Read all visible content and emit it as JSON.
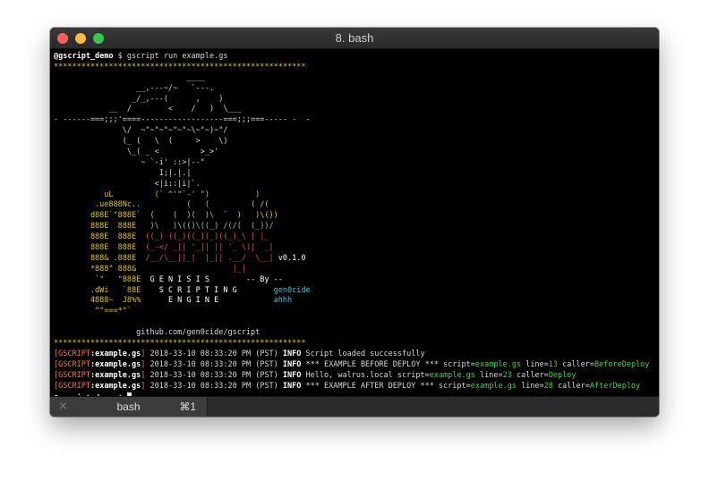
{
  "window": {
    "title": "8. bash"
  },
  "terminal": {
    "prompt_user": "@gscript_demo",
    "prompt_symbol": "$",
    "command": "gscript run example.gs",
    "separator": "*******************************************************",
    "art": [
      {
        "segs": [
          {
            "t": "                             ____",
            "c": ""
          }
        ]
      },
      {
        "segs": [
          {
            "t": "                  __,---~/~   `---.",
            "c": ""
          }
        ]
      },
      {
        "segs": [
          {
            "t": "                 _/_,---(      ,    )",
            "c": ""
          }
        ]
      },
      {
        "segs": [
          {
            "t": "            __  /        <    /   )  \\___",
            "c": ""
          }
        ]
      },
      {
        "segs": [
          {
            "t": "- ------===;;;'====------------------===;;;===----- -  -",
            "c": ""
          }
        ]
      },
      {
        "segs": [
          {
            "t": "               \\/  ~\"~\"~\"~\"~\"~\\~\"~)~\"/",
            "c": ""
          }
        ]
      },
      {
        "segs": [
          {
            "t": "               (_ (   \\  (     >    \\)",
            "c": ""
          }
        ]
      },
      {
        "segs": [
          {
            "t": "                \\_( _ <         >_>'",
            "c": ""
          }
        ]
      },
      {
        "segs": [
          {
            "t": "                   ~ `-i' ::>|--\"",
            "c": ""
          }
        ]
      },
      {
        "segs": [
          {
            "t": "                       I;|.|.|",
            "c": ""
          }
        ]
      },
      {
        "segs": [
          {
            "t": "                      <|i::|i|`.",
            "c": ""
          }
        ]
      },
      {
        "segs": [
          {
            "t": "           uL         (` ^'\"`-' \")          )",
            "c": "y"
          }
        ]
      },
      {
        "segs": [
          {
            "t": "         .ue888Nc..          (   (         ( /(",
            "c": "y"
          }
        ]
      },
      {
        "segs": [
          {
            "t": "        d88E`\"888E`  ",
            "c": "y"
          },
          {
            "t": "(    (  )(  )\\  `  )   )\\())",
            "c": "y"
          }
        ]
      },
      {
        "segs": [
          {
            "t": "        888E  888E   ",
            "c": "y"
          },
          {
            "t": ")\\   )\\(()\\((_) /(/(  (_))/",
            "c": "g"
          }
        ]
      },
      {
        "segs": [
          {
            "t": "        888E  888E  ",
            "c": "y"
          },
          {
            "t": "((_) ((_)((_)(_)((_)_\\ | |_",
            "c": "r"
          }
        ]
      },
      {
        "segs": [
          {
            "t": "        888E  888E  ",
            "c": "y"
          },
          {
            "t": "(_-</ _|| '_|| || '_ \\)|  _|",
            "c": "r"
          }
        ]
      },
      {
        "segs": [
          {
            "t": "        888& .888E  ",
            "c": "y"
          },
          {
            "t": "/__/\\__||_|  |_|| .__/  \\__| ",
            "c": "r"
          },
          {
            "t": "v0.1.0",
            "c": "w"
          }
        ]
      },
      {
        "segs": [
          {
            "t": "        *888\" 888&                     ",
            "c": "y"
          },
          {
            "t": "|_|",
            "c": "r"
          }
        ]
      },
      {
        "segs": [
          {
            "t": "         `\"   \"888E  ",
            "c": "y"
          },
          {
            "t": "G E N I S I S        -- By --",
            "c": "w"
          }
        ]
      },
      {
        "segs": [
          {
            "t": "        .dWi   `88E    ",
            "c": "y"
          },
          {
            "t": "S C R I P T I N G",
            "c": "w"
          },
          {
            "t": "        gen0cide",
            "c": "c"
          }
        ]
      },
      {
        "segs": [
          {
            "t": "        4888~  J8%%      ",
            "c": "y"
          },
          {
            "t": "E N G I N E",
            "c": "w"
          },
          {
            "t": "            ahhh",
            "c": "c"
          }
        ]
      },
      {
        "segs": [
          {
            "t": "         ^\"===*\"`",
            "c": "y"
          }
        ]
      }
    ],
    "url": "github.com/gen0cide/gscript",
    "logs": [
      {
        "tag": "GSCRIPT",
        "file": "example.gs",
        "time": "2018-33-10 08:33:20 PM (PST)",
        "level": "INFO",
        "segs": [
          {
            "t": "Script loaded successfully",
            "c": ""
          }
        ]
      },
      {
        "tag": "GSCRIPT",
        "file": "example.gs",
        "time": "2018-33-10 08:33:20 PM (PST)",
        "level": "INFO",
        "segs": [
          {
            "t": "*** EXAMPLE BEFORE DEPLOY *** script=",
            "c": ""
          },
          {
            "t": "example.gs",
            "c": "gr"
          },
          {
            "t": " line=",
            "c": ""
          },
          {
            "t": "13",
            "c": "gr"
          },
          {
            "t": " caller=",
            "c": ""
          },
          {
            "t": "BeforeDeploy",
            "c": "gr"
          }
        ]
      },
      {
        "tag": "GSCRIPT",
        "file": "example.gs",
        "time": "2018-33-10 08:33:20 PM (PST)",
        "level": "INFO",
        "segs": [
          {
            "t": "Hello, walrus.local script=",
            "c": ""
          },
          {
            "t": "example.gs",
            "c": "gr"
          },
          {
            "t": " line=",
            "c": ""
          },
          {
            "t": "23",
            "c": "gr"
          },
          {
            "t": " caller=",
            "c": ""
          },
          {
            "t": "Deploy",
            "c": "gr"
          }
        ]
      },
      {
        "tag": "GSCRIPT",
        "file": "example.gs",
        "time": "2018-33-10 08:33:20 PM (PST)",
        "level": "INFO",
        "segs": [
          {
            "t": "*** EXAMPLE AFTER DEPLOY *** script=",
            "c": ""
          },
          {
            "t": "example.gs",
            "c": "gr"
          },
          {
            "t": " line=",
            "c": ""
          },
          {
            "t": "28",
            "c": "gr"
          },
          {
            "t": " caller=",
            "c": ""
          },
          {
            "t": "AfterDeploy",
            "c": "gr"
          }
        ]
      }
    ]
  },
  "tab": {
    "label": "bash",
    "shortcut": "⌘1",
    "close_icon": "×"
  },
  "colors": {
    "red": "#fc605c",
    "yellow": "#fdbc40",
    "green": "#34c84a",
    "accent_orange": "#f07a4a",
    "accent_green": "#3ed63e"
  }
}
